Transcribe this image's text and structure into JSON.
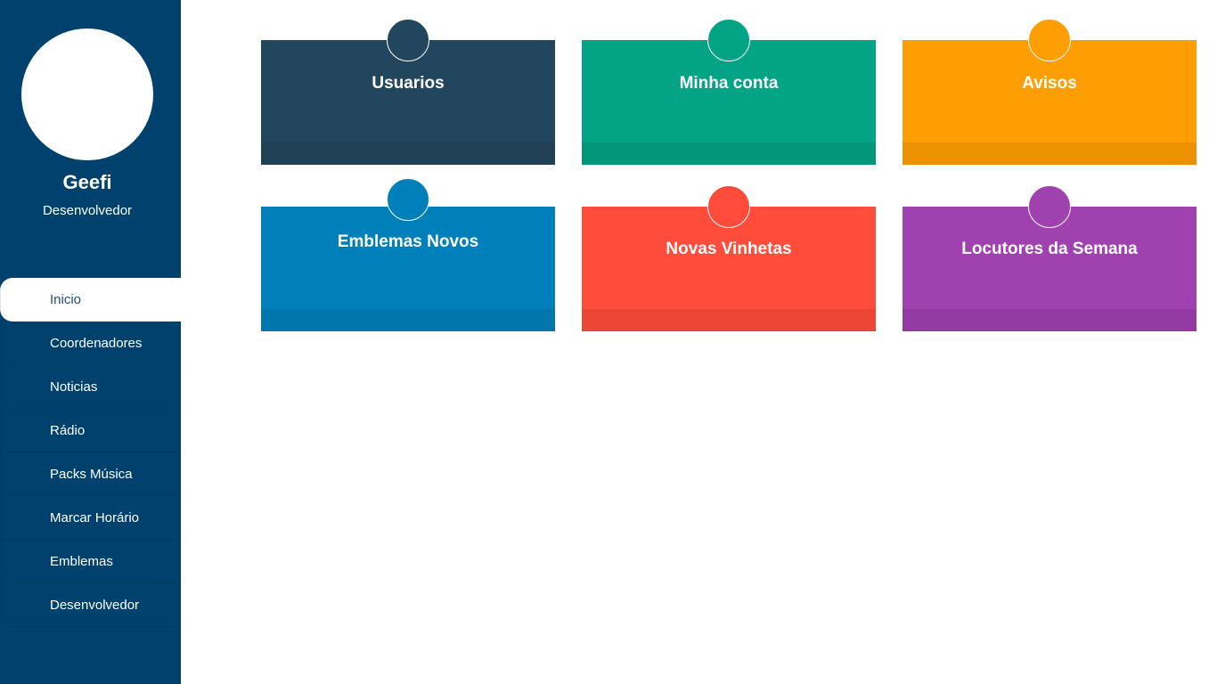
{
  "profile": {
    "name": "Geefi",
    "role": "Desenvolvedor"
  },
  "nav": {
    "items": [
      {
        "label": "Inicio",
        "active": true
      },
      {
        "label": "Coordenadores"
      },
      {
        "label": "Noticias"
      },
      {
        "label": "Rádio"
      },
      {
        "label": "Packs Música"
      },
      {
        "label": "Marcar Horário"
      },
      {
        "label": "Emblemas"
      },
      {
        "label": "Desenvolvedor"
      }
    ]
  },
  "tiles": [
    {
      "label": "Usuarios",
      "color": "#23465f"
    },
    {
      "label": "Minha conta",
      "color": "#03a386"
    },
    {
      "label": "Avisos",
      "color": "#ff9e03"
    },
    {
      "label": "Emblemas Novos",
      "color": "#0080bb"
    },
    {
      "label": "Novas Vinhetas",
      "color": "#ff4c3b"
    },
    {
      "label": "Locutores da Semana",
      "color": "#a041b0"
    }
  ],
  "colors": {
    "sidebar": "#00426d",
    "active_text": "#1f4d73"
  }
}
